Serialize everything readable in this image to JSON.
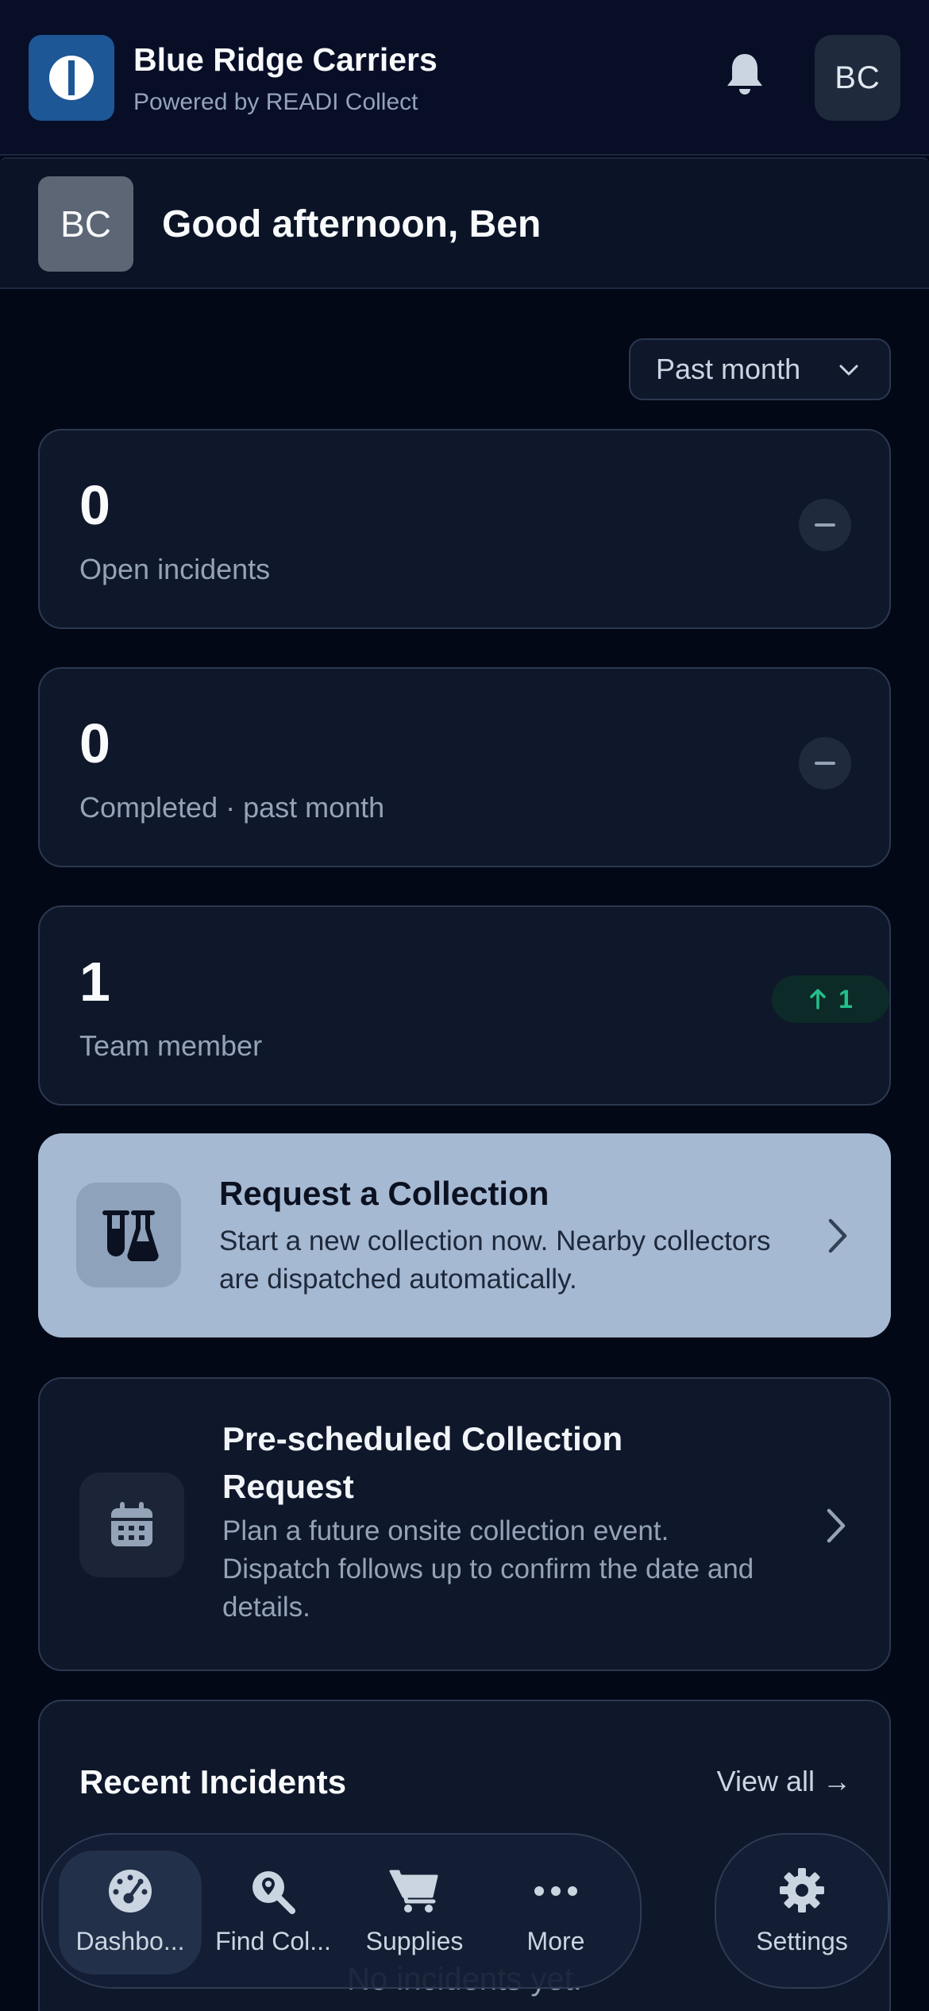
{
  "header": {
    "brand_name": "Blue Ridge Carriers",
    "brand_sub": "Powered by READI Collect",
    "avatar_initials": "BC",
    "notification_icon": "bell-icon",
    "logo_icon": "readi-logo-icon"
  },
  "greeting": {
    "avatar_initials": "BC",
    "text": "Good afternoon, Ben"
  },
  "filter": {
    "period_value": "Past month"
  },
  "stats": [
    {
      "value": "0",
      "label": "Open incidents",
      "trend": "neutral"
    },
    {
      "value": "0",
      "label": "Completed · past month",
      "trend": "neutral"
    },
    {
      "value": "1",
      "label": "Team member",
      "trend": "up",
      "trend_value": "1"
    }
  ],
  "actions": {
    "request": {
      "title": "Request a Collection",
      "desc": "Start a new collection now. Nearby collectors are dispatched automatically.",
      "icon": "flask-icon"
    },
    "prescheduled": {
      "title": "Pre-scheduled Collection Request",
      "desc": "Plan a future onsite collection event. Dispatch follows up to confirm the date and details.",
      "icon": "calendar-icon"
    }
  },
  "incidents": {
    "title": "Recent Incidents",
    "view_all": "View all →",
    "empty": "No incidents yet."
  },
  "nav": {
    "items": [
      {
        "label": "Dashbo...",
        "icon": "dashboard-icon"
      },
      {
        "label": "Find Col...",
        "icon": "search-location-icon"
      },
      {
        "label": "Supplies",
        "icon": "cart-icon"
      },
      {
        "label": "More",
        "icon": "more-icon"
      }
    ],
    "settings": {
      "label": "Settings",
      "icon": "gear-icon"
    }
  },
  "colors": {
    "background": "#030817",
    "card": "#0f172a",
    "primary_action": "#a6b9d2",
    "brand": "#1d5796",
    "positive": "#22c08a"
  }
}
